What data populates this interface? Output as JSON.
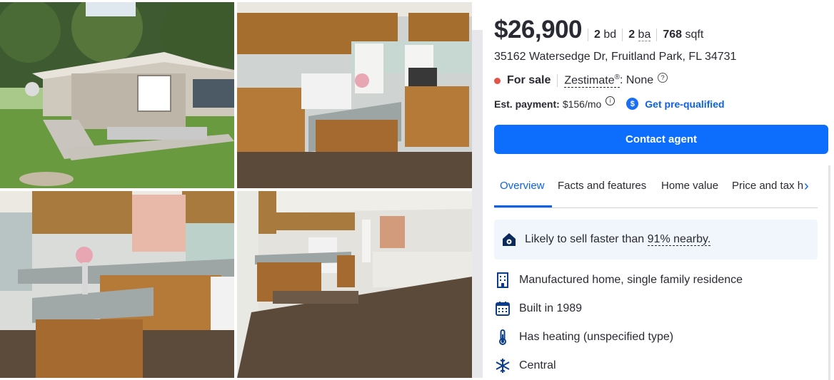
{
  "listing": {
    "price": "$26,900",
    "beds_value": "2",
    "beds_unit": "bd",
    "baths_value": "2",
    "baths_unit": "ba",
    "sqft_value": "768",
    "sqft_unit": "sqft",
    "address": "35162 Watersedge Dr, Fruitland Park, FL 34731",
    "status": "For sale",
    "zestimate_label": "Zestimate",
    "zestimate_reg": "®",
    "zestimate_value": ": None",
    "est_payment_label": "Est. payment:",
    "est_payment_value": "$156/mo",
    "prequal_label": "Get pre-qualified",
    "contact_label": "Contact agent"
  },
  "tabs": [
    {
      "label": "Overview",
      "active": true
    },
    {
      "label": "Facts and features"
    },
    {
      "label": "Home value"
    },
    {
      "label": "Price and tax h"
    }
  ],
  "highlight": {
    "prefix": "Likely to sell faster than ",
    "pct": "91% nearby."
  },
  "facts": [
    {
      "icon": "building-icon",
      "text": "Manufactured home, single family residence"
    },
    {
      "icon": "calendar-icon",
      "text": "Built in 1989"
    },
    {
      "icon": "thermometer-icon",
      "text": "Has heating (unspecified type)"
    },
    {
      "icon": "snowflake-icon",
      "text": "Central"
    }
  ],
  "colors": {
    "accent": "#0d6efd",
    "status_dot": "#e3544b",
    "highlight_bg": "#f1f6fc"
  },
  "icons": {
    "dollar": "$",
    "question": "?",
    "info": "i",
    "chevron": "›"
  }
}
